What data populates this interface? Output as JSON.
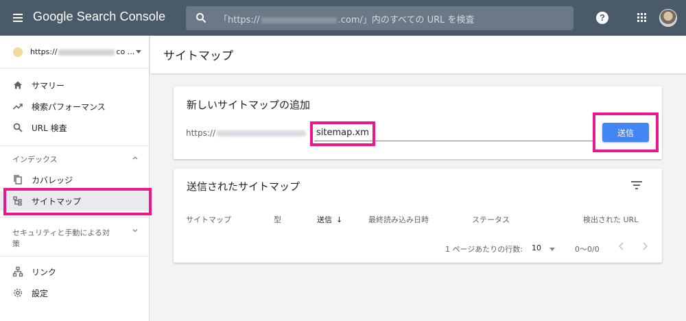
{
  "header": {
    "app_title": "Google Search Console",
    "search_placeholder": "「https://",
    "search_placeholder_tail": ".com/」内のすべての URL を検査",
    "help_label": "?"
  },
  "sidebar": {
    "property_prefix": "https://",
    "property_suffix": "co ...",
    "items_top": [
      {
        "label": "サマリー",
        "icon": "home-icon"
      },
      {
        "label": "検索パフォーマンス",
        "icon": "trending-up-icon"
      },
      {
        "label": "URL 検査",
        "icon": "search-icon"
      }
    ],
    "section_index": "インデックス",
    "items_index": [
      {
        "label": "カバレッジ",
        "icon": "copy-icon"
      },
      {
        "label": "サイトマップ",
        "icon": "sitemap-icon"
      }
    ],
    "section_security_line1": "セキュリティと手動による対",
    "section_security_line2": "策",
    "items_bottom": [
      {
        "label": "リンク",
        "icon": "links-icon"
      },
      {
        "label": "設定",
        "icon": "gear-icon"
      }
    ]
  },
  "main": {
    "page_title": "サイトマップ",
    "add_card": {
      "title": "新しいサイトマップの追加",
      "url_prefix": "https://",
      "input_value": "sitemap.xml",
      "submit_label": "送信"
    },
    "submitted_card": {
      "title": "送信されたサイトマップ",
      "columns": [
        "サイトマップ",
        "型",
        "送信",
        "最終読み込み日時",
        "ステータス",
        "検出された URL"
      ],
      "sort_indicator": "↓",
      "rows_per_page_label": "1 ページあたりの行数:",
      "rows_per_page_value": "10",
      "range_text": "0～0/0"
    }
  },
  "colors": {
    "topbar": "#4a5a68",
    "accent_blue": "#4285f4",
    "annotation_pink": "#ed168f"
  }
}
